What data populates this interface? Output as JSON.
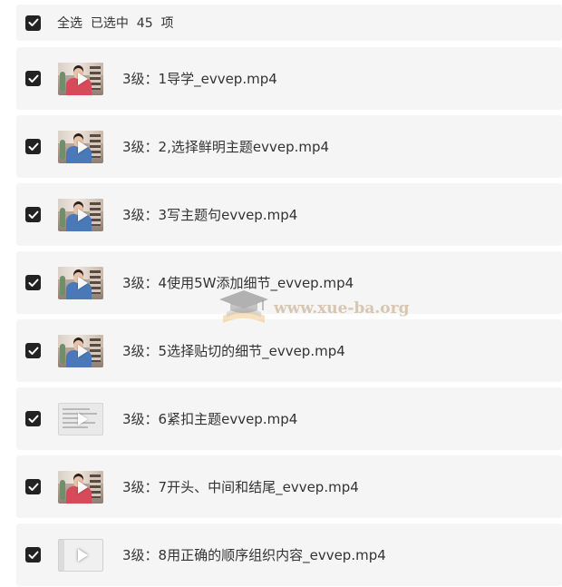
{
  "header": {
    "select_all_label": "全选",
    "selected_text": "已选中  45  项",
    "checked": true
  },
  "files": [
    {
      "name": "3级：1导学_evvep.mp4",
      "checked": true,
      "thumb": "person-red"
    },
    {
      "name": "3级：2,选择鲜明主题evvep.mp4",
      "checked": true,
      "thumb": "person-blue"
    },
    {
      "name": "3级：3写主题句evvep.mp4",
      "checked": true,
      "thumb": "person-blue"
    },
    {
      "name": "3级：4使用5W添加细节_evvep.mp4",
      "checked": true,
      "thumb": "person-blue"
    },
    {
      "name": "3级：5选择贴切的细节_evvep.mp4",
      "checked": true,
      "thumb": "person-blue"
    },
    {
      "name": "3级：6紧扣主题evvep.mp4",
      "checked": true,
      "thumb": "document"
    },
    {
      "name": "3级：7开头、中间和结尾_evvep.mp4",
      "checked": true,
      "thumb": "person-red"
    },
    {
      "name": "3级：8用正确的顺序组织内容_evvep.mp4",
      "checked": true,
      "thumb": "slide"
    }
  ],
  "watermark": {
    "text": "www.xue-ba.org",
    "icon": "graduation-cap-book-icon"
  },
  "colors": {
    "row_background": "#f5f5f5",
    "checkbox_fill": "#222222",
    "text": "#333333"
  }
}
